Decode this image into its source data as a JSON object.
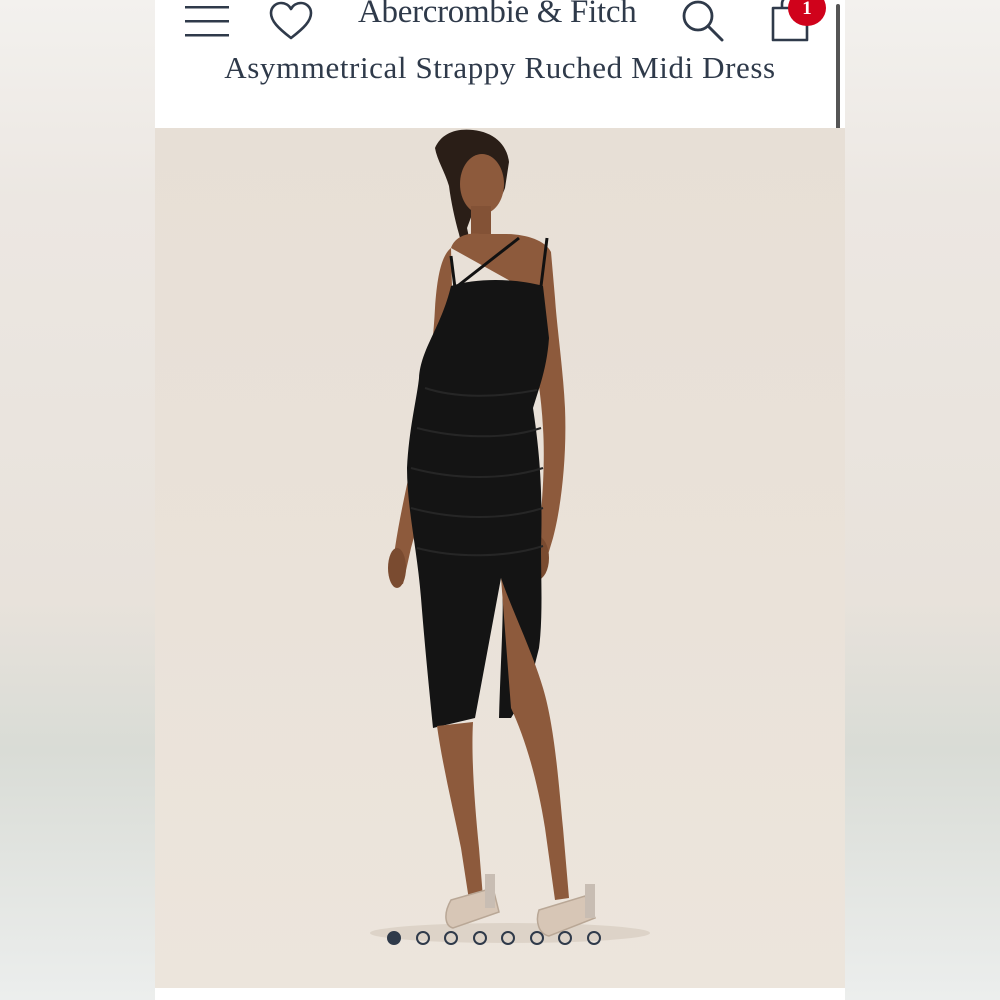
{
  "header": {
    "brand": "Abercrombie & Fitch",
    "cart_count": "1",
    "icons": {
      "menu": "hamburger-menu-icon",
      "wishlist": "heart-icon",
      "search": "search-icon",
      "cart": "shopping-bag-icon"
    }
  },
  "product": {
    "title": "Asymmetrical Strappy Ruched Midi Dress"
  },
  "gallery": {
    "image_count": 8,
    "active_index": 0
  },
  "colors": {
    "brand_navy": "#2f3a4a",
    "badge_red": "#d0021b"
  }
}
